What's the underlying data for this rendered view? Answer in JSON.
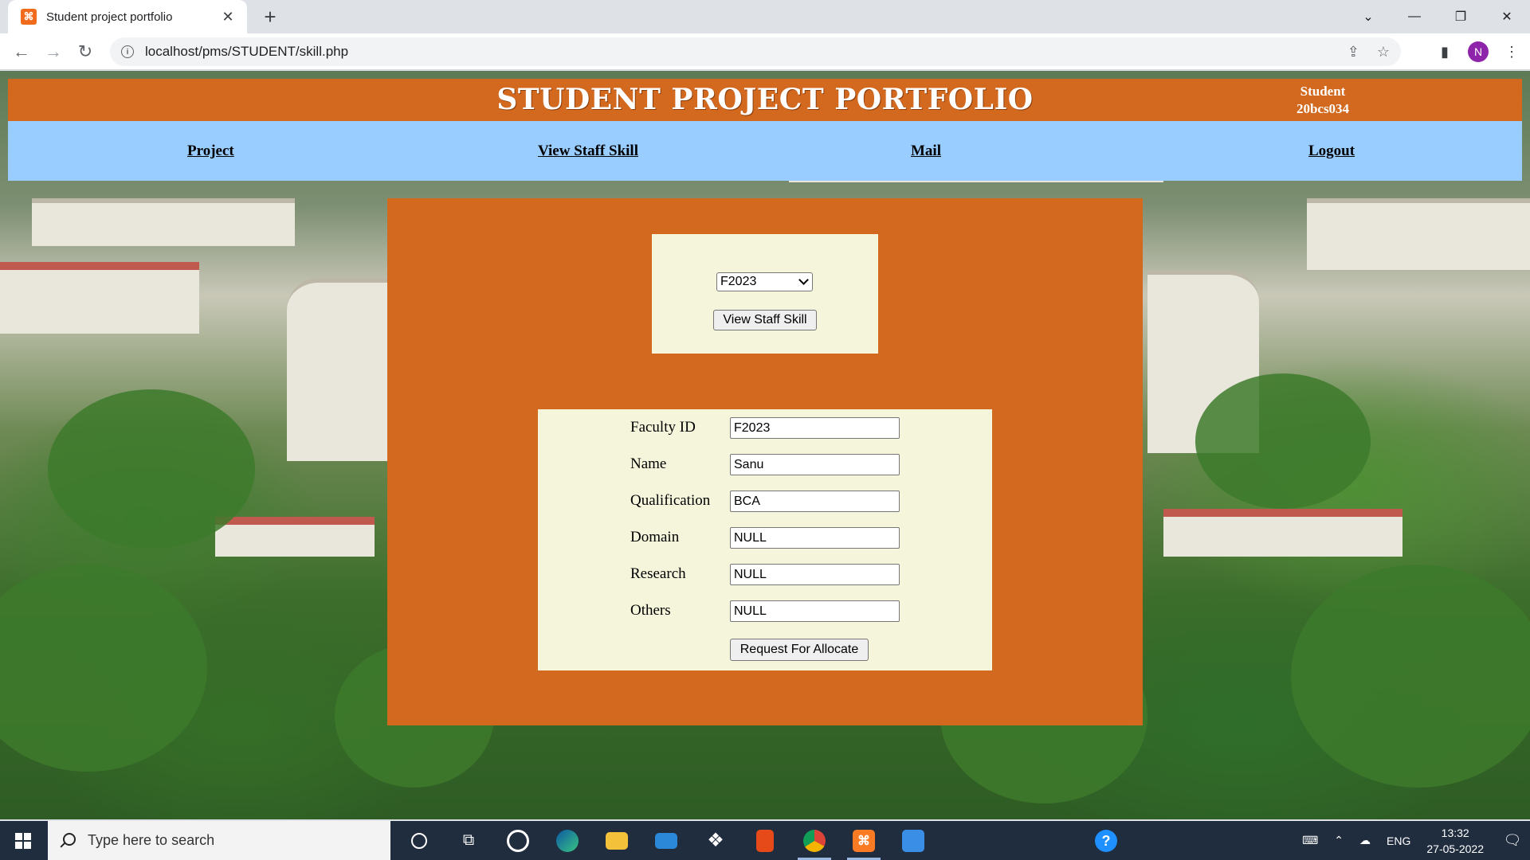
{
  "browser": {
    "tab_title": "Student project portfolio",
    "tab_favicon": "xampp-icon",
    "close_glyph": "✕",
    "new_tab_glyph": "+",
    "url": "localhost/pms/STUDENT/skill.php",
    "profile_initial": "N",
    "window_controls": [
      "⌄",
      "—",
      "❐",
      "✕"
    ]
  },
  "header": {
    "title": "STUDENT PROJECT PORTFOLIO",
    "user_role": "Student",
    "user_id": "20bcs034",
    "color": "#d2691e"
  },
  "nav": {
    "color": "#99ccff",
    "items": [
      {
        "label": "Project"
      },
      {
        "label": "View Staff Skill"
      },
      {
        "label": "Mail"
      },
      {
        "label": "Logout"
      }
    ]
  },
  "selector": {
    "selected_faculty": "F2023",
    "button_label": "View Staff Skill"
  },
  "form": {
    "fields": [
      {
        "label": "Faculty ID",
        "value": "F2023"
      },
      {
        "label": "Name",
        "value": "Sanu"
      },
      {
        "label": "Qualification",
        "value": "BCA"
      },
      {
        "label": "Domain",
        "value": "NULL"
      },
      {
        "label": "Research",
        "value": "NULL"
      },
      {
        "label": "Others",
        "value": "NULL"
      }
    ],
    "submit_label": "Request For Allocate"
  },
  "taskbar": {
    "search_placeholder": "Type here to search",
    "language": "ENG",
    "time": "13:32",
    "date": "27-05-2022",
    "apps": [
      "cortana-icon",
      "task-view-icon",
      "app-icon",
      "edge-icon",
      "file-explorer-icon",
      "mail-icon",
      "dropbox-icon",
      "office-icon",
      "chrome-icon",
      "xampp-icon",
      "photos-icon"
    ]
  }
}
